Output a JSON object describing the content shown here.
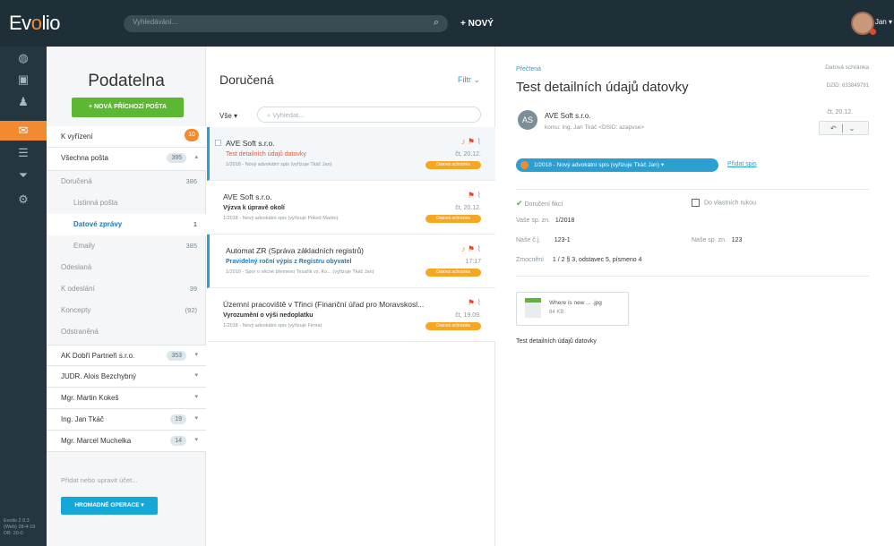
{
  "app": {
    "logo": "Evolio",
    "logo_left": "Ev",
    "logo_o": "o",
    "logo_right": "lio"
  },
  "topbar": {
    "search_placeholder": "Vyhledávání...",
    "new_label": "+ NOVÝ",
    "user_name": "Jan"
  },
  "rail": {
    "icons": [
      "globe-icon",
      "briefcase-icon",
      "user-icon",
      "inbox-icon",
      "list-icon",
      "filter-icon",
      "gear-icon"
    ],
    "version_text": "Evolio 2 0.3 (Web) 28-4-19 DB: 20-0"
  },
  "sidebar": {
    "title": "Podatelna",
    "new_incoming_label": "+ NOVÁ PŘÍCHOZÍ POŠTA",
    "items": [
      {
        "label": "K vyřízení",
        "count": "10"
      },
      {
        "label": "Všechna pošta",
        "count": "395"
      },
      {
        "label": "Doručená",
        "count": "386"
      },
      {
        "label": "Listinná pošta",
        "count": ""
      },
      {
        "label": "Datové zprávy",
        "count": "1"
      },
      {
        "label": "Emaily",
        "count": "385"
      },
      {
        "label": "Odeslaná",
        "count": ""
      },
      {
        "label": "K odeslání",
        "count": "39"
      },
      {
        "label": "Koncepty",
        "count": "(92)"
      },
      {
        "label": "Odstraněná",
        "count": ""
      },
      {
        "label": "AK Dobří Partneři s.r.o.",
        "count": "353"
      },
      {
        "label": "JUDR. Alois Bezchybný",
        "count": ""
      },
      {
        "label": "Mgr. Martin Kokeš",
        "count": ""
      },
      {
        "label": "Ing. Jan Tkáč",
        "count": "19"
      },
      {
        "label": "Mgr. Marcel Muchelka",
        "count": "14"
      }
    ],
    "footer_link": "Přidat nebo upravit účet...",
    "bulk_label": "HROMADNÉ OPERACE ▾"
  },
  "list": {
    "title": "Doručená",
    "filter_label": "Filtr ⌄",
    "all_label": "Vše ▾",
    "search_placeholder": "Vyhledat...",
    "messages": [
      {
        "sender": "AVE Soft s.r.o.",
        "subject": "Test detailních údajů datovky",
        "meta": "1/2018 - Nový advokátní spis (vyřizuje Tkáč Jan)",
        "date": "čt, 20.12.",
        "tag": "Datová schránka"
      },
      {
        "sender": "AVE Soft s.r.o.",
        "subject": "Výzva k úpravě okolí",
        "meta": "1/2018 - Nový advokátní spis (vyřizuje Pokeš Martin)",
        "date": "čt, 20.12.",
        "tag": "Datová schránka"
      },
      {
        "sender": "Automat ZR (Správa základních registrů)",
        "subject": "Pravidelný roční výpis z Registru obyvatel",
        "meta": "1/2019 - Spor o věcné břemeno Tesařík vs. Ko... (vyřizuje Tkáč Jan)",
        "date": "17:17",
        "tag": "Datová schránka"
      },
      {
        "sender": "Územní pracoviště v Třinci (Finanční úřad pro Moravskosl...",
        "subject": "Vyrozumění o výši nedoplatku",
        "meta": "1/2018 - Nový advokátní spis (vyřizuje Firma)",
        "date": "čt, 19.09.",
        "tag": "Datová schránka"
      }
    ]
  },
  "detail": {
    "label": "Přečtená",
    "title": "Test detailních údajů datovky",
    "right_label": "Datová schránka",
    "right_id": "DZID: 633849791",
    "avatar": "AS",
    "from": "AVE Soft s.r.o.",
    "to": "komu: Ing. Jan Tkáč <DSID: azapvse>",
    "date": "čt, 20.12.",
    "case": "1/2018 - Nový advokátní spis (vyřizuje Tkáč Jan) ▾",
    "add_case": "Přidat spis",
    "delivered": "Doručení fikcí",
    "own_hands": "Do vlastních rukou",
    "your_ref_label": "Vaše sp. zn.",
    "your_ref": "1/2018",
    "our_no_label": "Naše č.j.",
    "our_no": "123-1",
    "our_ref_label": "Naše sp. zn.",
    "our_ref": "123",
    "authority_label": "Zmocnění",
    "authority": "1 / 2 § 3, odstavec 5, písmeno 4",
    "attachment_name": "Where is new ... .jpg",
    "attachment_size": "84 KB",
    "body": "Test detailních údajů datovky"
  }
}
